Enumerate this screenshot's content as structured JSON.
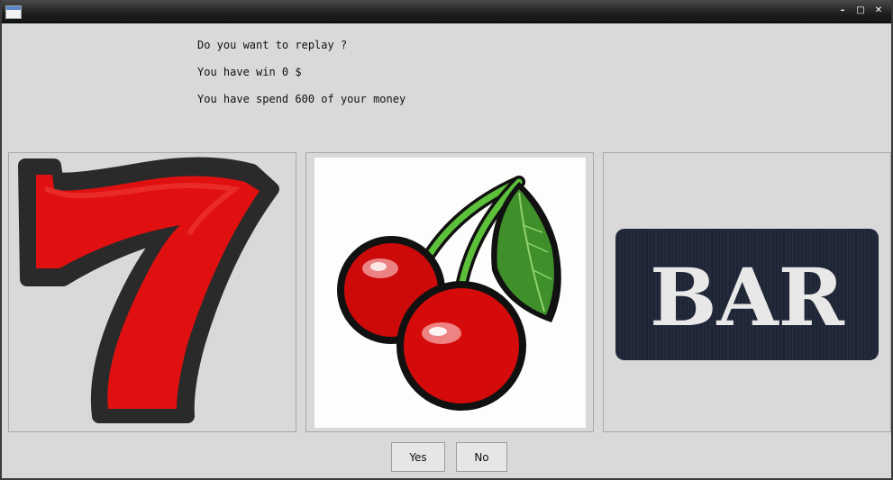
{
  "window": {
    "controls": {
      "minimize": "–",
      "maximize": "□",
      "close": "✕"
    }
  },
  "message": {
    "question": "Do you want to replay ?",
    "win": "You have win 0 $",
    "spend": "You have spend 600 of your money"
  },
  "reels": [
    {
      "symbol": "seven-icon"
    },
    {
      "symbol": "cherry-icon"
    },
    {
      "symbol": "bar-icon",
      "text": "BAR"
    }
  ],
  "buttons": {
    "yes": "Yes",
    "no": "No"
  },
  "colors": {
    "seven_red": "#e01010",
    "seven_outline": "#2a2a2a",
    "cherry_red": "#cc0a0a",
    "stem_green": "#5cc03a",
    "leaf_green": "#3f8f2a",
    "bar_bg": "#1e2433",
    "bar_text": "#e8e8e8"
  }
}
